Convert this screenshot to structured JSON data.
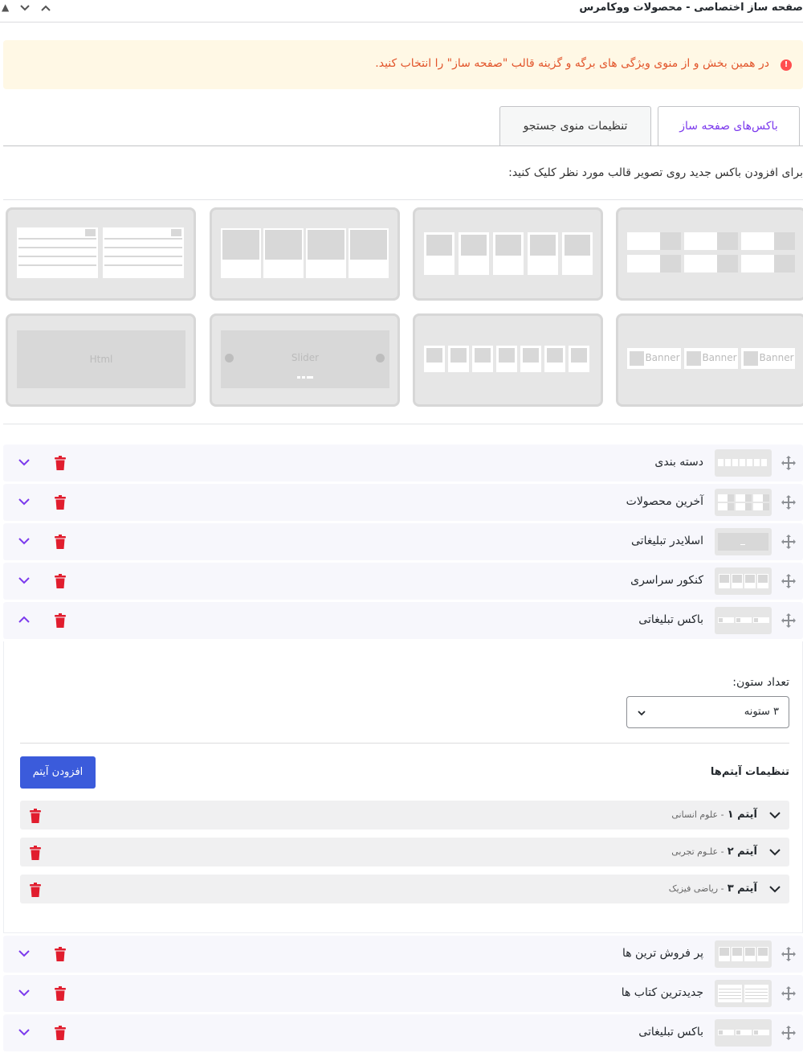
{
  "header": {
    "title": "صفحه ساز اختصاصی - محصولات ووکامرس"
  },
  "notice": {
    "text": "در همین بخش و از منوی ویژگی های برگه و گزینه قالب \"صفحه ساز\" را انتخاب کنید.",
    "icon": "exclamation-icon"
  },
  "tabs": [
    {
      "label": "باکس‌های صفحه ساز",
      "active": true
    },
    {
      "label": "تنظیمات منوی جستجو",
      "active": false
    }
  ],
  "instruction": "برای افزودن باکس جدید روی تصویر قالب مورد نظر کلیک کنید:",
  "templates": {
    "banner_label": "Banner",
    "slider_label": "Slider",
    "html_label": "Html"
  },
  "boxes": [
    {
      "name": "دسته بندی",
      "expanded": false
    },
    {
      "name": "آخرین محصولات",
      "expanded": false
    },
    {
      "name": "اسلایدر تبلیغاتی",
      "expanded": false
    },
    {
      "name": "کنکور سراسری",
      "expanded": false
    },
    {
      "name": "باکس تبلیغاتی",
      "expanded": true
    },
    {
      "name": "پر فروش ترین ها",
      "expanded": false
    },
    {
      "name": "جدیدترین کتاب ها",
      "expanded": false
    },
    {
      "name": "باکس تبلیغاتی",
      "expanded": false
    }
  ],
  "panel": {
    "columns_label": "تعداد ستون:",
    "columns_value": "۳ ستونه",
    "items_label": "تنظیمات آیتم‌ها",
    "add_button": "افزودن آیتم",
    "items": [
      {
        "title": "آیتم ۱",
        "subtitle": "- علوم انسانی"
      },
      {
        "title": "آیتم ۲",
        "subtitle": "- علـوم تجربی"
      },
      {
        "title": "آیتم ۳",
        "subtitle": "- ریاضی فیزیک"
      }
    ]
  },
  "colors": {
    "accent": "#7c3aed",
    "delete": "#e11d2e",
    "button": "#3b5bdb",
    "notice_bg": "#fff8e5",
    "notice_text": "#e2552b"
  }
}
